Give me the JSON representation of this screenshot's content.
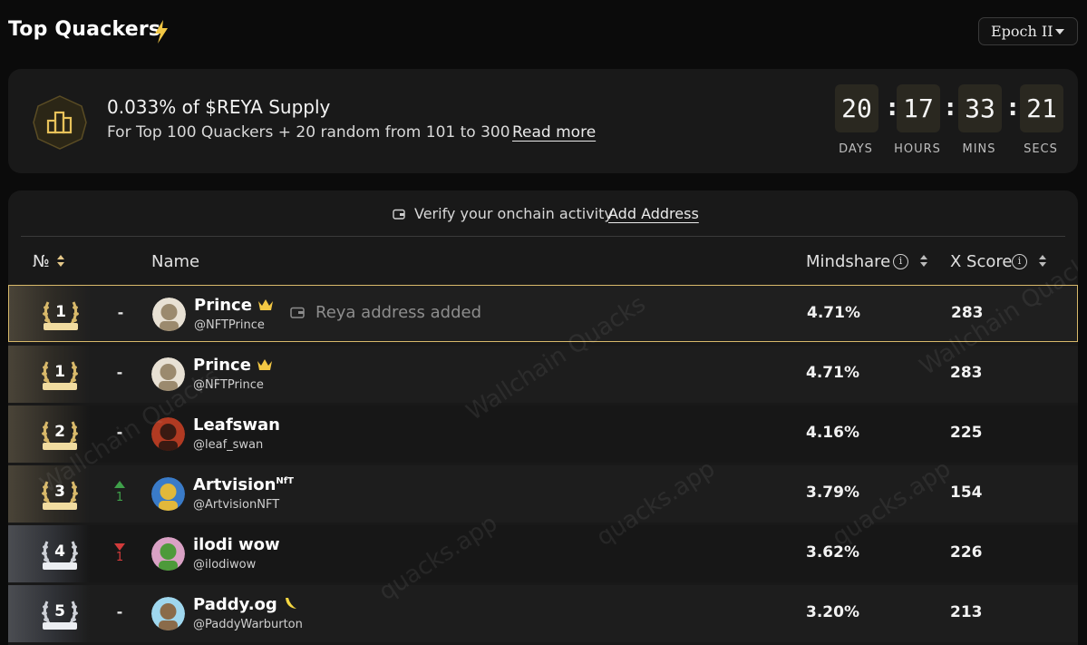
{
  "header": {
    "title": "Top Quackers",
    "epoch_label": "Epoch II"
  },
  "reward": {
    "title": "0.033% of $REYA Supply",
    "subtitle": "For Top 100 Quackers + 20 random from 101 to 300",
    "read_more": "Read more",
    "countdown": [
      {
        "value": "20",
        "label": "DAYS"
      },
      {
        "value": "17",
        "label": "HOURS"
      },
      {
        "value": "33",
        "label": "MINS"
      },
      {
        "value": "21",
        "label": "SECS"
      }
    ]
  },
  "verify": {
    "text": "Verify your onchain activity",
    "link": "Add Address"
  },
  "table": {
    "columns": {
      "rank": "№",
      "name": "Name",
      "mindshare": "Mindshare",
      "xscore": "X Score"
    },
    "current_user_note": "Reya address added",
    "rows": [
      {
        "rank": "1",
        "change": "-",
        "direction": "none",
        "name": "Prince",
        "badge": "crown",
        "handle": "@NFTPrince",
        "mindshare": "4.71%",
        "xscore": "283",
        "avatar": "ape-avatar",
        "medal": "gold"
      },
      {
        "rank": "1",
        "change": "-",
        "direction": "none",
        "name": "Prince",
        "badge": "crown",
        "handle": "@NFTPrince",
        "mindshare": "4.71%",
        "xscore": "283",
        "avatar": "ape-avatar",
        "medal": "gold"
      },
      {
        "rank": "2",
        "change": "-",
        "direction": "none",
        "name": "Leafswan",
        "badge": "",
        "handle": "@leaf_swan",
        "mindshare": "4.16%",
        "xscore": "225",
        "avatar": "portrait-avatar",
        "medal": "gold"
      },
      {
        "rank": "3",
        "change": "1",
        "direction": "up",
        "name": "Artvision",
        "name_sup": "NfT",
        "badge": "",
        "handle": "@ArtvisionNFT",
        "mindshare": "3.79%",
        "xscore": "154",
        "avatar": "trophy-avatar",
        "medal": "gold"
      },
      {
        "rank": "4",
        "change": "1",
        "direction": "down",
        "name": "ilodi wow",
        "badge": "",
        "handle": "@ilodiwow",
        "mindshare": "3.62%",
        "xscore": "226",
        "avatar": "pink-avatar",
        "medal": "silver"
      },
      {
        "rank": "5",
        "change": "-",
        "direction": "none",
        "name": "Paddy.og",
        "badge": "banana",
        "handle": "@PaddyWarburton",
        "mindshare": "3.20%",
        "xscore": "213",
        "avatar": "ape-blue-avatar",
        "medal": "silver"
      }
    ]
  },
  "watermarks": [
    "Wallchain Quacks",
    "Wallchain Quacks",
    "quacks.app",
    "quacks.app",
    "quacks.app",
    "Wallchain Quacks"
  ],
  "colors": {
    "accent_gold": "#d8b96a",
    "background": "#0b0b0b",
    "card": "#191919",
    "up": "#3fa04a",
    "down": "#d23b3b"
  }
}
